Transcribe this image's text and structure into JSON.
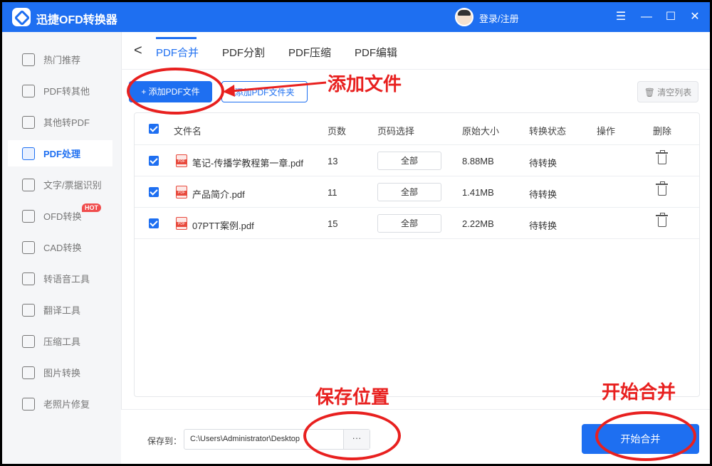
{
  "app": {
    "title": "迅捷OFD转换器",
    "login": "登录/注册",
    "controls": [
      "☰",
      "—",
      "☐",
      "✕"
    ]
  },
  "sidebar": [
    {
      "label": "热门推荐",
      "icon": "hot-icon",
      "active": false
    },
    {
      "label": "PDF转其他",
      "icon": "pdf-convert-icon",
      "active": false
    },
    {
      "label": "其他转PDF",
      "icon": "to-pdf-icon",
      "active": false
    },
    {
      "label": "PDF处理",
      "icon": "pdf-process-icon",
      "active": true
    },
    {
      "label": "文字/票据识别",
      "icon": "ocr-icon",
      "active": false
    },
    {
      "label": "OFD转换",
      "icon": "ofd-icon",
      "active": false,
      "badge": "HOT"
    },
    {
      "label": "CAD转换",
      "icon": "cad-icon",
      "active": false
    },
    {
      "label": "转语音工具",
      "icon": "voice-icon",
      "active": false
    },
    {
      "label": "翻译工具",
      "icon": "translate-icon",
      "active": false
    },
    {
      "label": "压缩工具",
      "icon": "compress-icon",
      "active": false
    },
    {
      "label": "图片转换",
      "icon": "image-icon",
      "active": false
    },
    {
      "label": "老照片修复",
      "icon": "photo-repair-icon",
      "active": false
    }
  ],
  "tabs": {
    "back": "<",
    "items": [
      "PDF合并",
      "PDF分割",
      "PDF压缩",
      "PDF编辑"
    ],
    "active": 0
  },
  "toolbar": {
    "add": "+ 添加PDF文件",
    "add_folder": "添加PDF文件夹",
    "clear": "🗑 清空列表"
  },
  "table": {
    "headers": [
      "文件名",
      "页数",
      "页码选择",
      "原始大小",
      "转换状态",
      "操作",
      "删除"
    ],
    "rows": [
      {
        "name": "笔记-传播学教程第一章.pdf",
        "pages": "13",
        "range": "全部",
        "size": "8.88MB",
        "status": "待转换"
      },
      {
        "name": "产品简介.pdf",
        "pages": "11",
        "range": "全部",
        "size": "1.41MB",
        "status": "待转换"
      },
      {
        "name": "07PTT案例.pdf",
        "pages": "15",
        "range": "全部",
        "size": "2.22MB",
        "status": "待转换"
      }
    ]
  },
  "bottom": {
    "save_label": "保存到：",
    "path": "C:\\Users\\Administrator\\Desktop",
    "more": "···",
    "start": "开始合并"
  },
  "annotations": {
    "add_file": "添加文件",
    "save_location": "保存位置",
    "start_merge": "开始合并",
    "color": "#e8201f"
  }
}
